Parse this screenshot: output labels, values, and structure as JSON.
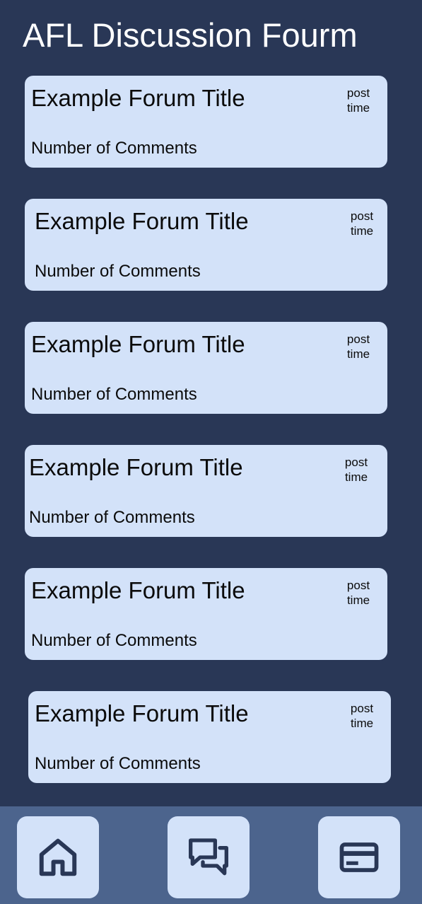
{
  "header": {
    "title": "AFL Discussion Fourm"
  },
  "forum_posts": [
    {
      "title": "Example Forum Title",
      "time_line1": "post",
      "time_line2": "time",
      "comments": "Number of Comments"
    },
    {
      "title": "Example Forum Title",
      "time_line1": "post",
      "time_line2": "time",
      "comments": "Number of Comments"
    },
    {
      "title": "Example Forum Title",
      "time_line1": "post",
      "time_line2": "time",
      "comments": "Number of Comments"
    },
    {
      "title": "Example Forum Title",
      "time_line1": "post",
      "time_line2": "time",
      "comments": "Number of Comments"
    },
    {
      "title": "Example Forum Title",
      "time_line1": "post",
      "time_line2": "time",
      "comments": "Number of Comments"
    },
    {
      "title": "Example Forum Title",
      "time_line1": "post",
      "time_line2": "time",
      "comments": "Number of Comments"
    }
  ],
  "bottom_nav": {
    "items": [
      {
        "icon": "home-icon"
      },
      {
        "icon": "chat-icon"
      },
      {
        "icon": "card-icon"
      }
    ]
  },
  "colors": {
    "background": "#293756",
    "card": "#d3e2f9",
    "nav_bar": "#4c648d",
    "icon": "#293756",
    "title_text": "#ffffff"
  }
}
